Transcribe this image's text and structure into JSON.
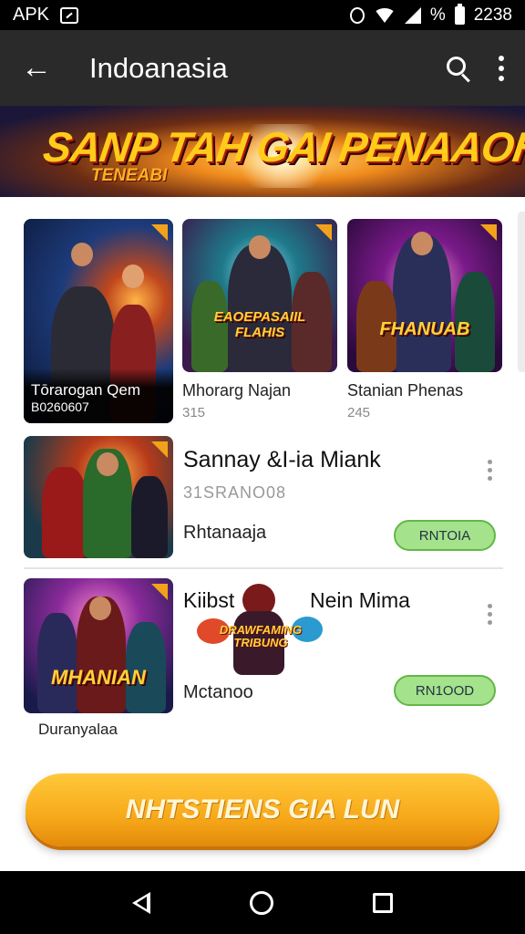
{
  "status_bar": {
    "left_text": "APK",
    "battery_percent": "%",
    "time": "2238"
  },
  "app_bar": {
    "title": "Indoanasia"
  },
  "banner": {
    "headline": "SANP TAH GAI PENAAOH!",
    "subline": "TENEABI"
  },
  "featured": [
    {
      "title": "Tōrarogan Qem",
      "subtitle": "B0260607",
      "logo": "",
      "palette": [
        "#1d3b7a",
        "#0a1430",
        "#ffb347"
      ]
    },
    {
      "title": "Mhorarg Najan",
      "subtitle": "315",
      "logo": "EAOEPASAIIL FLAHIS",
      "palette": [
        "#1e7a8a",
        "#3a1a4a",
        "#ffd23a"
      ]
    },
    {
      "title": "Stanian Phenas",
      "subtitle": "245",
      "logo": "FHANUAB",
      "palette": [
        "#7a1a8a",
        "#2a0a3a",
        "#ff4aa0"
      ]
    }
  ],
  "list_items": [
    {
      "title": "Sannay &I-ia Miank",
      "meta": "31SRANO08",
      "name": "Rhtanaaja",
      "button": "RNTOIA",
      "art_logo": ""
    },
    {
      "title_left": "Kiibst",
      "title_right": "Nein Mima",
      "name": "Mctanoo",
      "button": "RN1OOD",
      "art_logo": "MHANIAN",
      "overlay_logo": "DRAWFAMING TRIBUNG",
      "caption": "Duranyalaa"
    }
  ],
  "cta": {
    "label": "NHTSTIENS GIA LUN"
  },
  "colors": {
    "app_bar": "#2a2a2a",
    "button_green": "#a5e28c",
    "cta_orange": "#f7a91a"
  }
}
